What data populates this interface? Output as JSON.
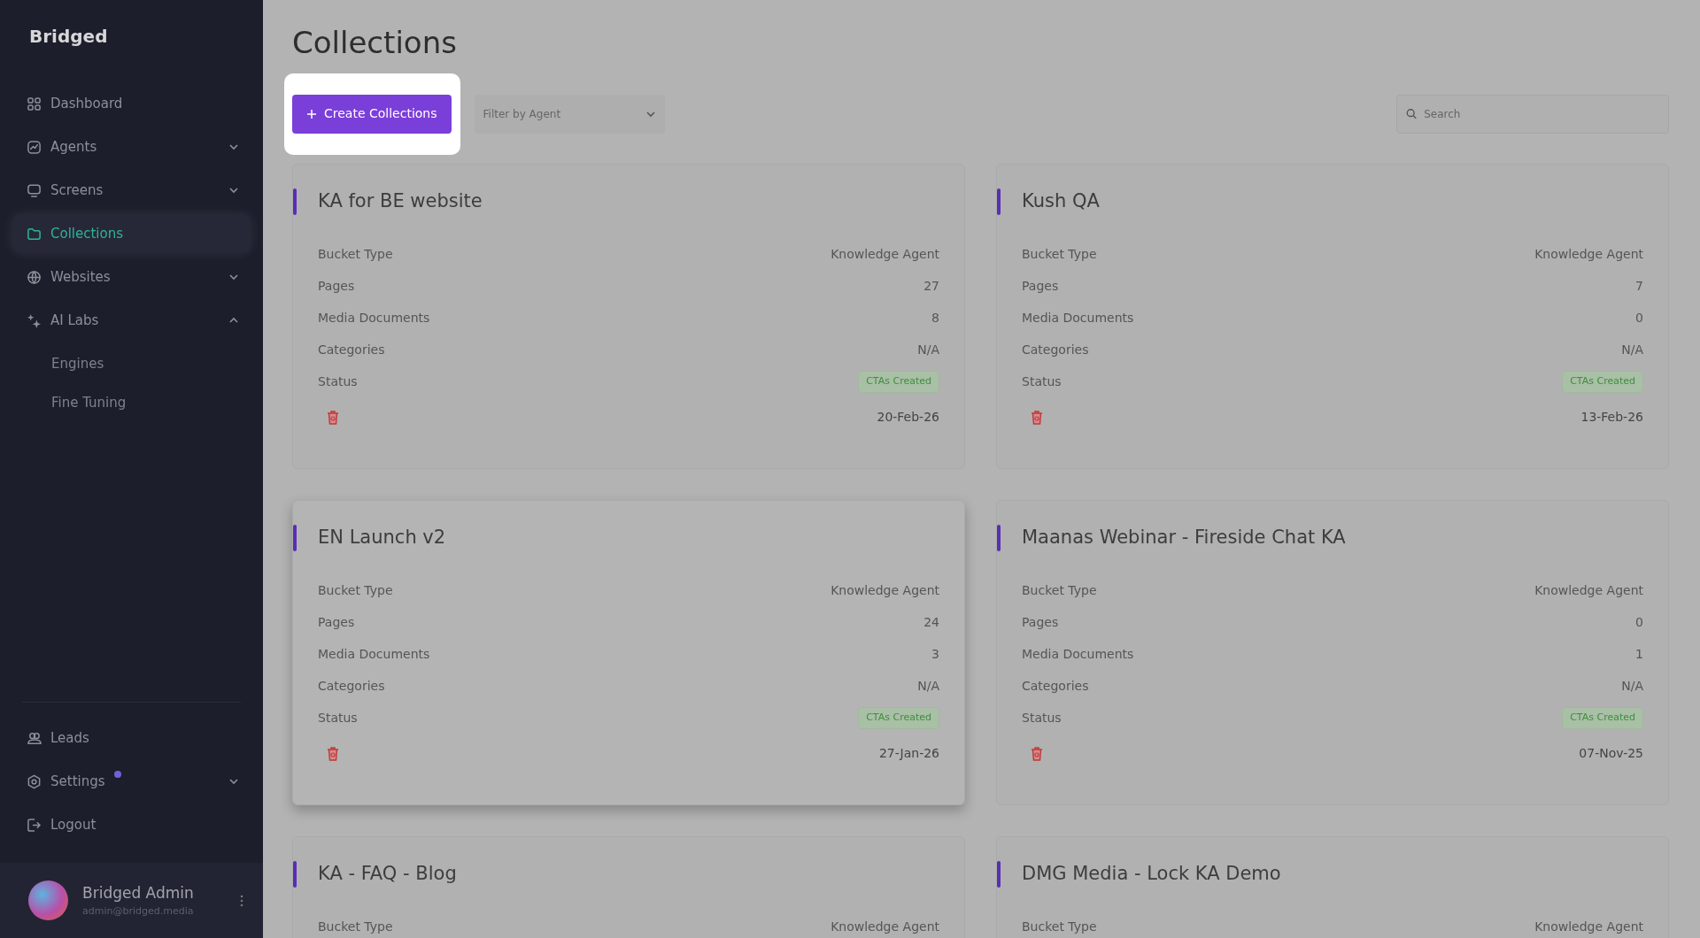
{
  "brand": "Bridged",
  "nav": [
    {
      "label": "Dashboard",
      "selected": false
    },
    {
      "label": "Agents",
      "selected": false,
      "expanded": false
    },
    {
      "label": "Screens",
      "selected": false,
      "expanded": false
    },
    {
      "label": "Collections",
      "selected": true
    },
    {
      "label": "Websites",
      "selected": false,
      "expanded": false
    },
    {
      "label": "AI Labs",
      "selected": false,
      "expanded": true,
      "children": [
        {
          "label": "Engines"
        },
        {
          "label": "Fine Tuning"
        }
      ]
    }
  ],
  "nav_bottom": [
    {
      "label": "Leads",
      "selected": false
    },
    {
      "label": "Settings",
      "selected": false,
      "expanded": false,
      "notification": true
    },
    {
      "label": "Logout",
      "selected": false
    }
  ],
  "user": {
    "name": "Bridged Admin",
    "email": "admin@bridged.media"
  },
  "page_title": "Collections",
  "create_button": "Create Collections",
  "filter": {
    "placeholder": "Filter by Agent"
  },
  "search": {
    "placeholder": "Search"
  },
  "cards": [
    {
      "title": "KA for BE website",
      "hovered": false,
      "rows": [
        {
          "label": "Bucket Type",
          "value": "Knowledge Agent"
        },
        {
          "label": "Pages",
          "value": "27"
        },
        {
          "label": "Media Documents",
          "value": "8"
        },
        {
          "label": "Categories",
          "value": "N/A"
        }
      ],
      "status_label": "Status",
      "status": "CTAs Created",
      "date": "20-Feb-26"
    },
    {
      "title": "Kush QA",
      "hovered": false,
      "rows": [
        {
          "label": "Bucket Type",
          "value": "Knowledge Agent"
        },
        {
          "label": "Pages",
          "value": "7"
        },
        {
          "label": "Media Documents",
          "value": "0"
        },
        {
          "label": "Categories",
          "value": "N/A"
        }
      ],
      "status_label": "Status",
      "status": "CTAs Created",
      "date": "13-Feb-26"
    },
    {
      "title": "EN Launch v2",
      "hovered": true,
      "rows": [
        {
          "label": "Bucket Type",
          "value": "Knowledge Agent"
        },
        {
          "label": "Pages",
          "value": "24"
        },
        {
          "label": "Media Documents",
          "value": "3"
        },
        {
          "label": "Categories",
          "value": "N/A"
        }
      ],
      "status_label": "Status",
      "status": "CTAs Created",
      "date": "27-Jan-26"
    },
    {
      "title": "Maanas Webinar - Fireside Chat KA",
      "hovered": false,
      "rows": [
        {
          "label": "Bucket Type",
          "value": "Knowledge Agent"
        },
        {
          "label": "Pages",
          "value": "0"
        },
        {
          "label": "Media Documents",
          "value": "1"
        },
        {
          "label": "Categories",
          "value": "N/A"
        }
      ],
      "status_label": "Status",
      "status": "CTAs Created",
      "date": "07-Nov-25"
    },
    {
      "title": "KA - FAQ - Blog",
      "hovered": false,
      "rows": [
        {
          "label": "Bucket Type",
          "value": "Knowledge Agent"
        }
      ]
    },
    {
      "title": "DMG Media - Lock KA Demo",
      "hovered": false,
      "rows": [
        {
          "label": "Bucket Type",
          "value": "Knowledge Agent"
        }
      ]
    }
  ]
}
